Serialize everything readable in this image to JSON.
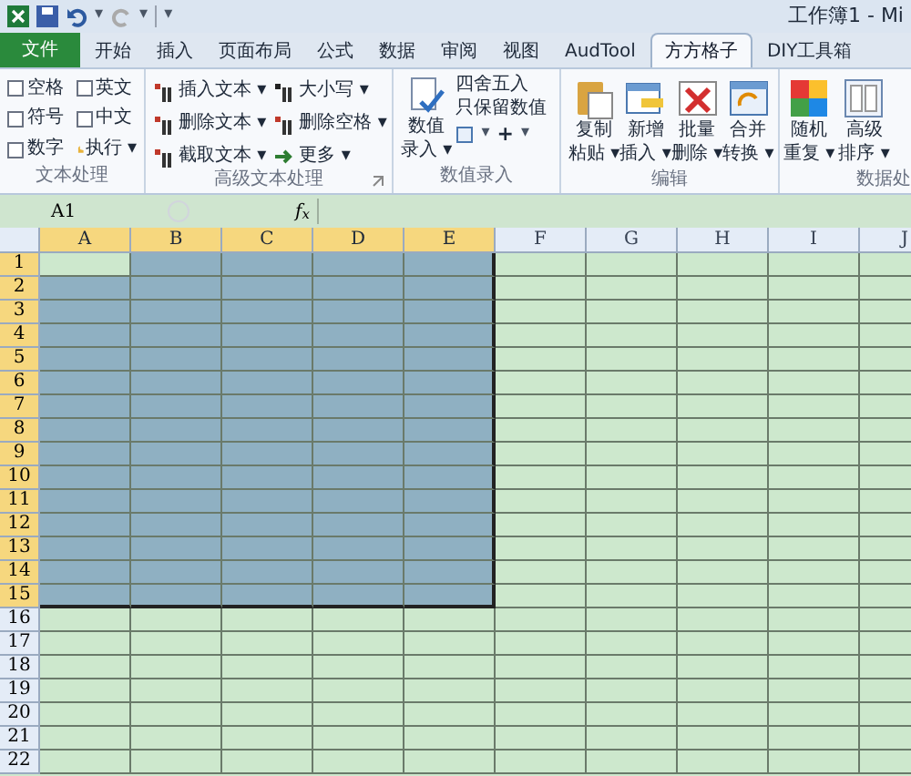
{
  "window": {
    "title": "工作簿1 - Mi"
  },
  "quick_access": {
    "undo": "▾",
    "redo": "▾",
    "customize": "▾"
  },
  "tabs": [
    {
      "label": "文件",
      "kind": "file",
      "selected": false
    },
    {
      "label": "开始",
      "kind": "tab",
      "selected": false
    },
    {
      "label": "插入",
      "kind": "tab",
      "selected": false
    },
    {
      "label": "页面布局",
      "kind": "tab",
      "selected": false
    },
    {
      "label": "公式",
      "kind": "tab",
      "selected": false
    },
    {
      "label": "数据",
      "kind": "tab",
      "selected": false
    },
    {
      "label": "审阅",
      "kind": "tab",
      "selected": false
    },
    {
      "label": "视图",
      "kind": "tab",
      "selected": false
    },
    {
      "label": "AudTool",
      "kind": "tab",
      "selected": false
    },
    {
      "label": "方方格子",
      "kind": "tab",
      "selected": true
    },
    {
      "label": "DIY工具箱",
      "kind": "tab",
      "selected": false
    }
  ],
  "ribbon": {
    "text_group": {
      "label": "文本处理",
      "options": [
        {
          "label": "空格",
          "checked": false
        },
        {
          "label": "英文",
          "checked": false
        },
        {
          "label": "符号",
          "checked": false
        },
        {
          "label": "中文",
          "checked": false
        },
        {
          "label": "数字",
          "checked": false
        }
      ],
      "run": "执行 ▾"
    },
    "advanced_group": {
      "label": "高级文本处理",
      "buttons": [
        {
          "label": "插入文本 ▾",
          "kind": "insert"
        },
        {
          "label": "删除文本 ▾",
          "kind": "delete"
        },
        {
          "label": "截取文本 ▾",
          "kind": "extract"
        },
        {
          "label": "大小写 ▾",
          "kind": "case"
        },
        {
          "label": "删除空格 ▾",
          "kind": "space"
        },
        {
          "label": "更多 ▾",
          "kind": "more"
        }
      ]
    },
    "number_group": {
      "label": "数值录入",
      "big": [
        "数值",
        "录入 ▾"
      ],
      "round": "四舍五入",
      "keep": "只保留数值",
      "menu1": "▾",
      "plus": "+",
      "menu2": "▾"
    },
    "edit_group": {
      "label": "编辑",
      "buttons": [
        {
          "lines": [
            "复制",
            "粘贴 ▾"
          ],
          "kind": "paste"
        },
        {
          "lines": [
            "新增",
            "插入 ▾"
          ],
          "kind": "insert"
        },
        {
          "lines": [
            "批量",
            "删除 ▾"
          ],
          "kind": "delete"
        },
        {
          "lines": [
            "合并",
            "转换 ▾"
          ],
          "kind": "merge"
        }
      ]
    },
    "data_group": {
      "label": "数据处",
      "buttons": [
        {
          "lines": [
            "随机",
            "重复 ▾"
          ],
          "kind": "random"
        },
        {
          "lines": [
            "高级",
            "排序 ▾"
          ],
          "kind": "sort"
        }
      ]
    }
  },
  "formula_bar": {
    "name_box": "A1",
    "fx": "f$_{x}$"
  },
  "sheet": {
    "columns": [
      {
        "label": "A",
        "selected": true
      },
      {
        "label": "B",
        "selected": true
      },
      {
        "label": "C",
        "selected": true
      },
      {
        "label": "D",
        "selected": true
      },
      {
        "label": "E",
        "selected": true
      },
      {
        "label": "F",
        "selected": false
      },
      {
        "label": "G",
        "selected": false
      },
      {
        "label": "H",
        "selected": false
      },
      {
        "label": "I",
        "selected": false
      },
      {
        "label": "J",
        "selected": false
      }
    ],
    "rows": [
      {
        "label": "1",
        "selected": true
      },
      {
        "label": "2",
        "selected": true
      },
      {
        "label": "3",
        "selected": true
      },
      {
        "label": "4",
        "selected": true
      },
      {
        "label": "5",
        "selected": true
      },
      {
        "label": "6",
        "selected": true
      },
      {
        "label": "7",
        "selected": true
      },
      {
        "label": "8",
        "selected": true
      },
      {
        "label": "9",
        "selected": true
      },
      {
        "label": "10",
        "selected": true
      },
      {
        "label": "11",
        "selected": true
      },
      {
        "label": "12",
        "selected": true
      },
      {
        "label": "13",
        "selected": true
      },
      {
        "label": "14",
        "selected": true
      },
      {
        "label": "15",
        "selected": true
      },
      {
        "label": "16",
        "selected": false
      },
      {
        "label": "17",
        "selected": false
      },
      {
        "label": "18",
        "selected": false
      },
      {
        "label": "19",
        "selected": false
      },
      {
        "label": "20",
        "selected": false
      },
      {
        "label": "21",
        "selected": false
      },
      {
        "label": "22",
        "selected": false
      }
    ]
  }
}
